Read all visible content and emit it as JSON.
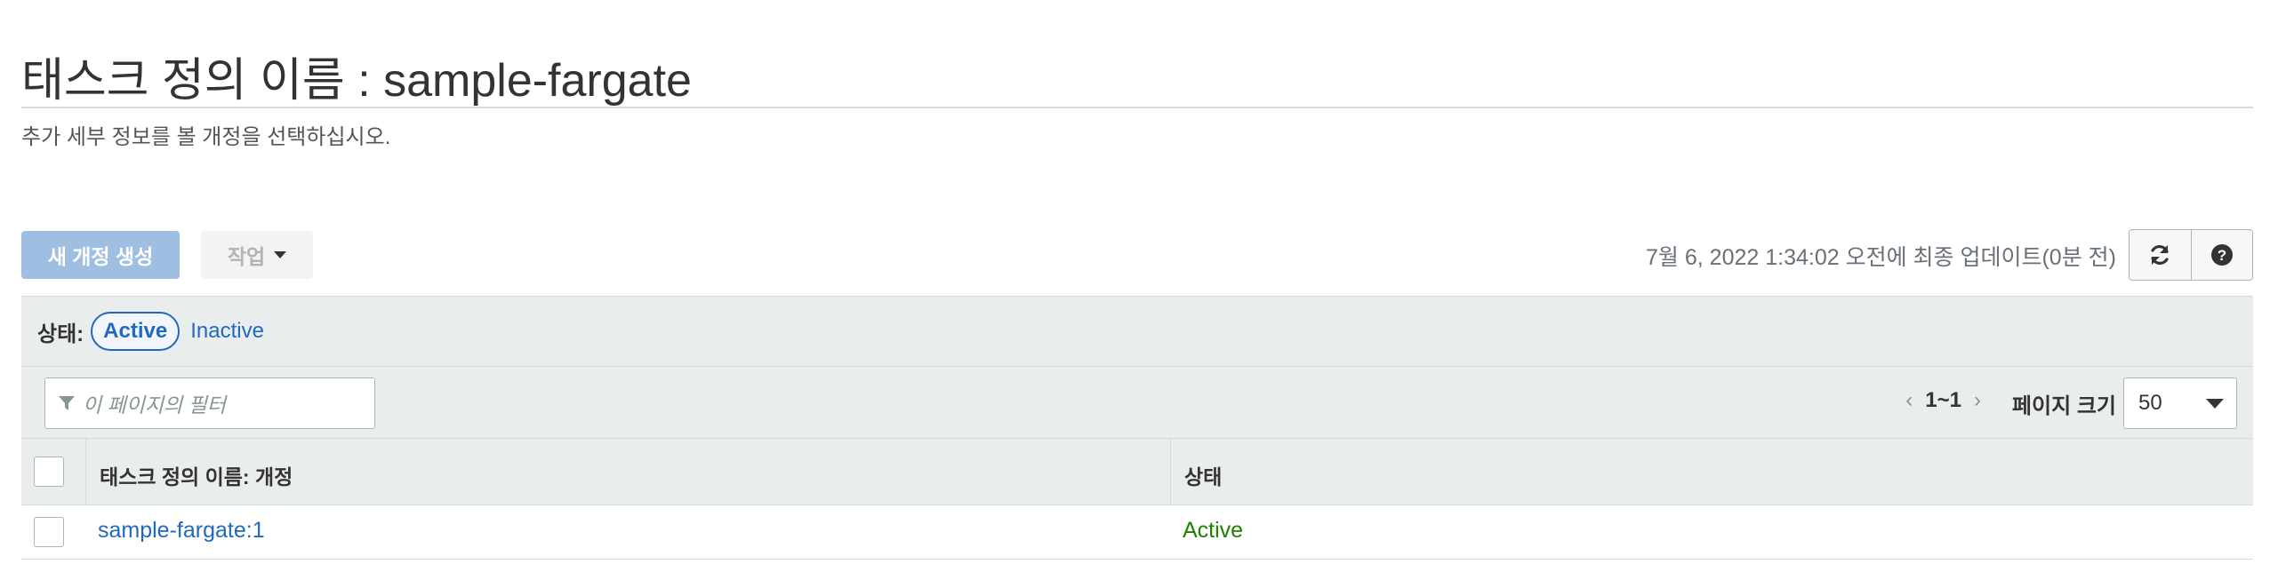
{
  "header": {
    "title": "태스크 정의 이름 : sample-fargate",
    "subtitle": "추가 세부 정보를 볼 개정을 선택하십시오."
  },
  "toolbar": {
    "create_label": "새 개정 생성",
    "actions_label": "작업",
    "last_updated": "7월 6, 2022 1:34:02 오전에 최종 업데이트(0분 전)",
    "refresh_icon": "refresh-icon",
    "help_icon": "help-icon"
  },
  "status_filter": {
    "label": "상태:",
    "active": "Active",
    "inactive": "Inactive"
  },
  "filter": {
    "placeholder": "이 페이지의 필터"
  },
  "pagination": {
    "prev": "‹",
    "range": "1~1",
    "next": "›",
    "page_size_label": "페이지 크기",
    "page_size_value": "50"
  },
  "table": {
    "columns": [
      "태스크 정의 이름: 개정",
      "상태"
    ],
    "rows": [
      {
        "name": "sample-fargate:1",
        "status": "Active"
      }
    ]
  },
  "colors": {
    "link": "#1f6abf",
    "status_active": "#1d8102",
    "primary_button": "#9fbfe2",
    "header_bg": "#eaeded"
  }
}
